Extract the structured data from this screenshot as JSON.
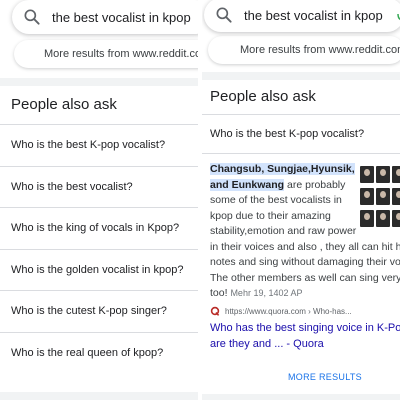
{
  "left": {
    "search": {
      "query": "the best vocalist in kpop"
    },
    "more_results_label": "More results from www.reddit.com",
    "paa_heading": "People also ask",
    "questions": [
      "Who is the best K-pop vocalist?",
      "Who is the best vocalist?",
      "Who is the king of vocals in Kpop?",
      "Who is the golden vocalist in kpop?",
      "Who is the cutest K-pop singer?",
      "Who is the real queen of kpop?"
    ]
  },
  "right": {
    "search": {
      "query": "the best vocalist in kpop"
    },
    "more_results_label": "More results from www.reddit.com",
    "more_results_chevron": ">",
    "paa_heading": "People also ask",
    "expanded_question": "Who is the best K-pop vocalist?",
    "answer": {
      "highlight_1": "Changsub, Sungjae,Hyunsik,",
      "highlight_2": "and Eunkwang",
      "rest_1": " are probably",
      "line_3": "some of the best vocalists in",
      "line_4": "kpop due to their amazing",
      "line_5": "stability,emotion and raw power",
      "line_6": "in their voices and also , they all can hit high",
      "line_7": "notes and sing without damaging their voic",
      "line_8": "The other members as well can sing very w",
      "line_9": "too!",
      "date": "Mehr 19, 1402 AP"
    },
    "source": {
      "url": "https://www.quora.com › Who-has...",
      "link_line_1": "Who has the best singing voice in K-Pop? W",
      "link_line_2": "are they and ... - Quora"
    },
    "more_results_button": "MORE RESULTS"
  },
  "colors": {
    "link": "#1a0dab",
    "highlight": "#d2e3fc",
    "accent_blue": "#1a73e8",
    "quora_red": "#b92b27",
    "divider": "#dadce0"
  },
  "icons": [
    "search-icon",
    "mic-icon",
    "chevron-right-icon",
    "quora-icon"
  ]
}
